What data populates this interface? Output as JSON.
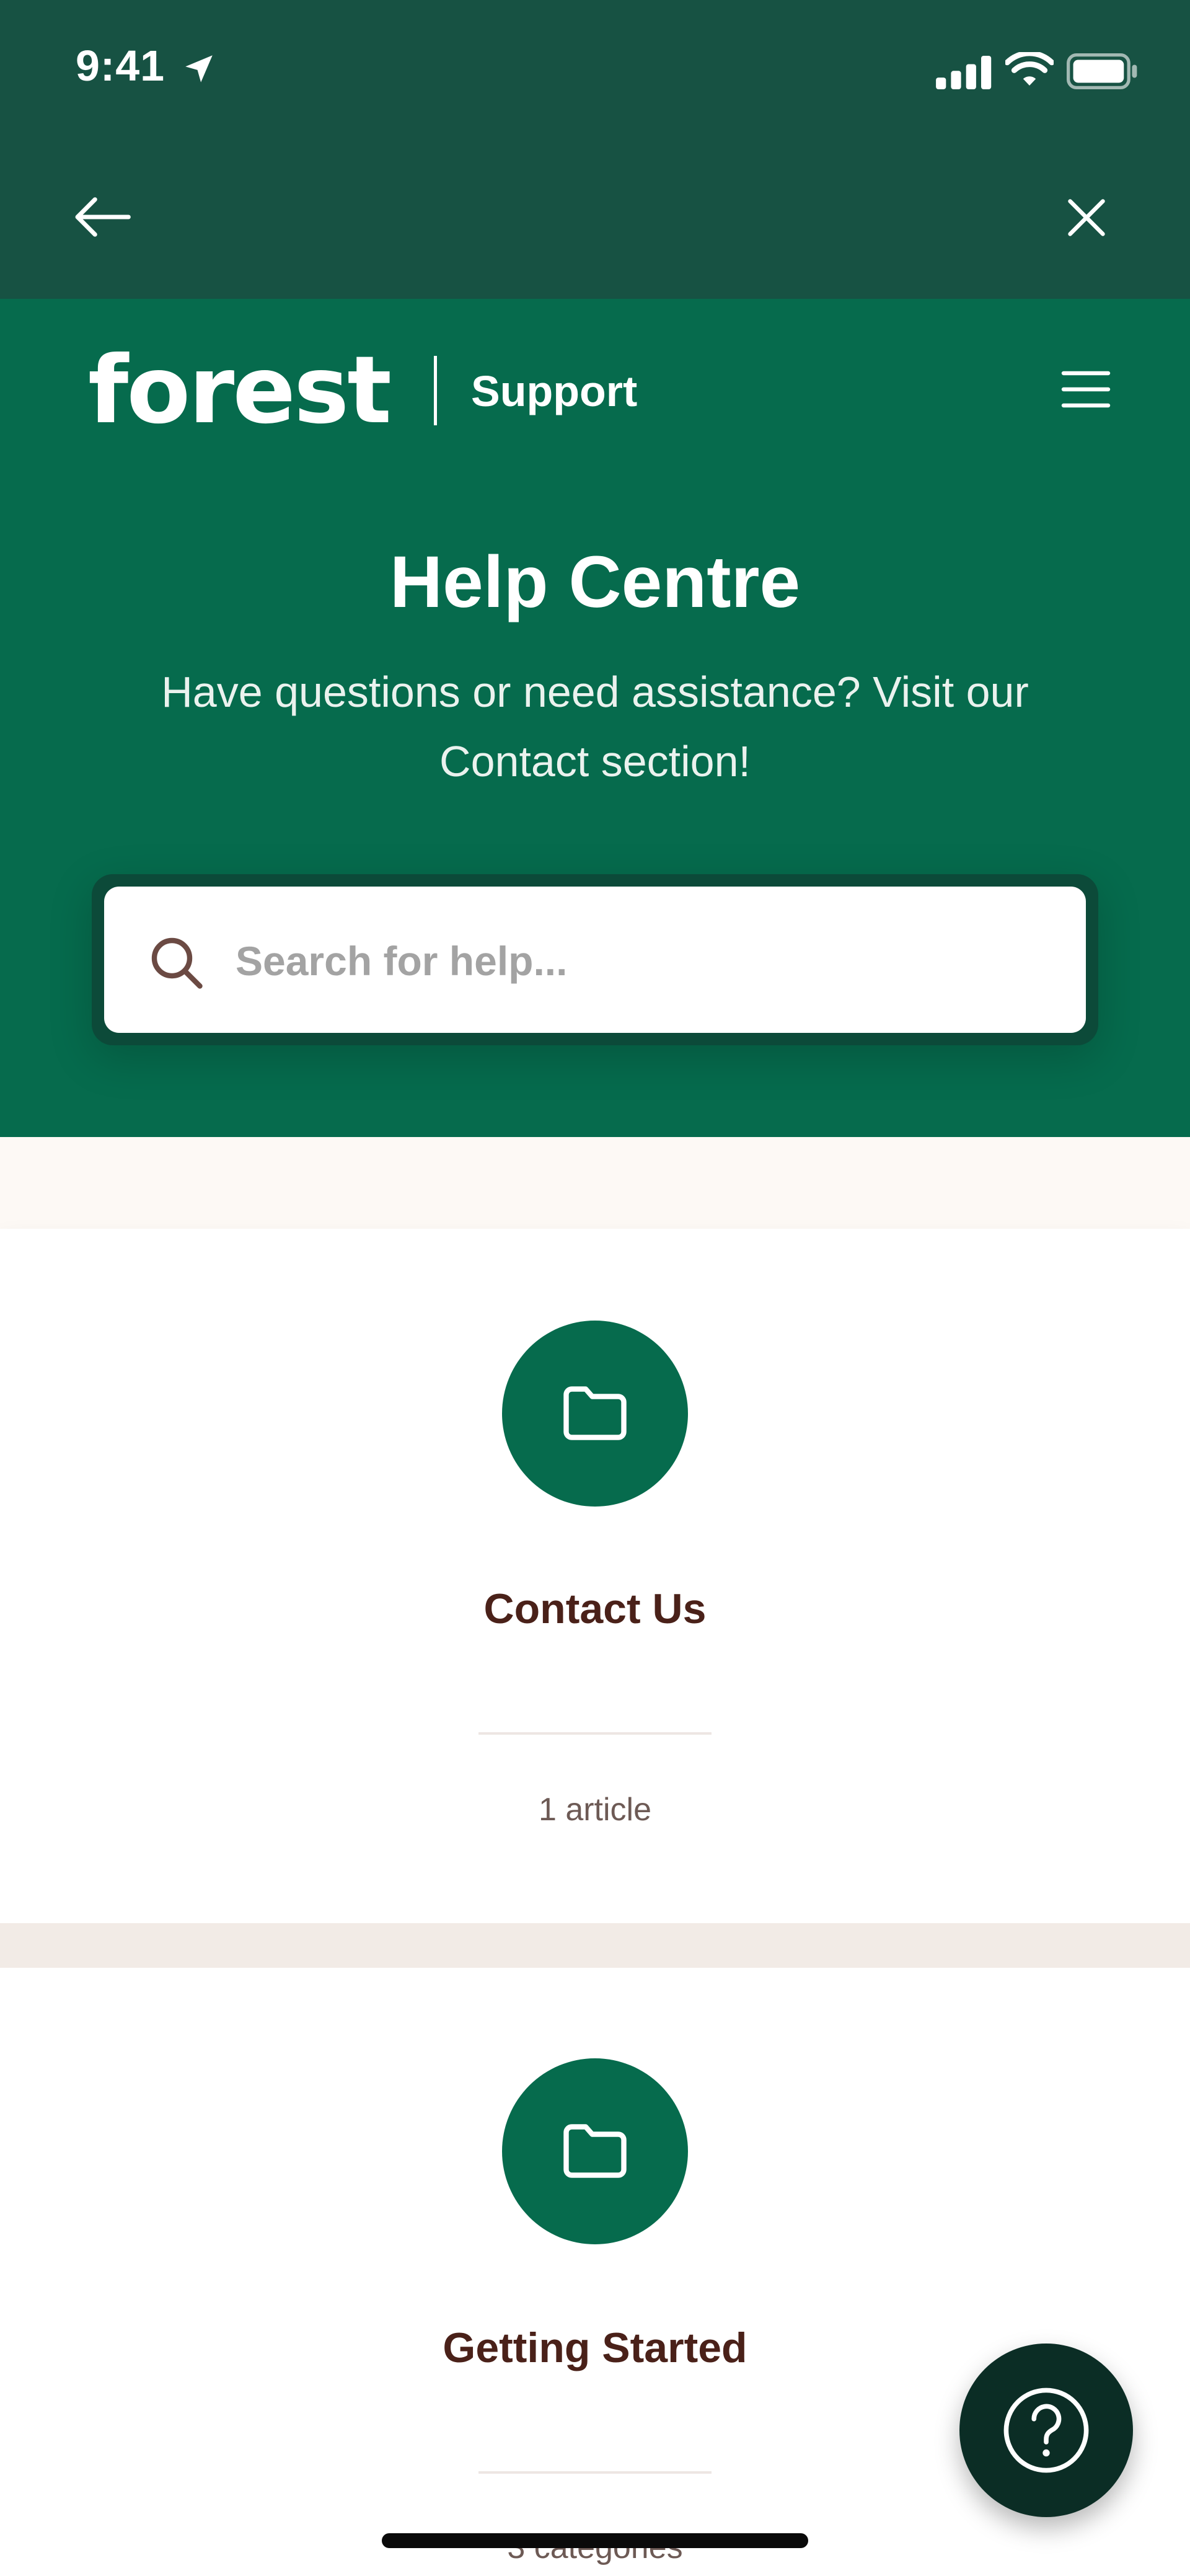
{
  "status_bar": {
    "time": "9:41"
  },
  "nav": {
    "back_icon": "arrow-left-icon",
    "close_icon": "close-icon"
  },
  "header": {
    "brand": "forest",
    "section": "Support",
    "menu_icon": "hamburger-icon"
  },
  "hero": {
    "title": "Help Centre",
    "subtitle": "Have questions or need assistance? Visit our Contact section!"
  },
  "search": {
    "placeholder": "Search for help...",
    "value": ""
  },
  "categories": [
    {
      "title": "Contact Us",
      "meta": "1 article",
      "icon": "folder-icon"
    },
    {
      "title": "Getting Started",
      "meta": "3 categories",
      "icon": "folder-icon"
    }
  ],
  "help_button": {
    "icon": "question-mark-icon"
  },
  "colors": {
    "top_chrome": "#175243",
    "brand_green": "#066b4d",
    "search_frame": "#0c4a39",
    "title_brown": "#4a2119",
    "fab": "#0b2d25",
    "page_bg": "#fdf9f5"
  }
}
